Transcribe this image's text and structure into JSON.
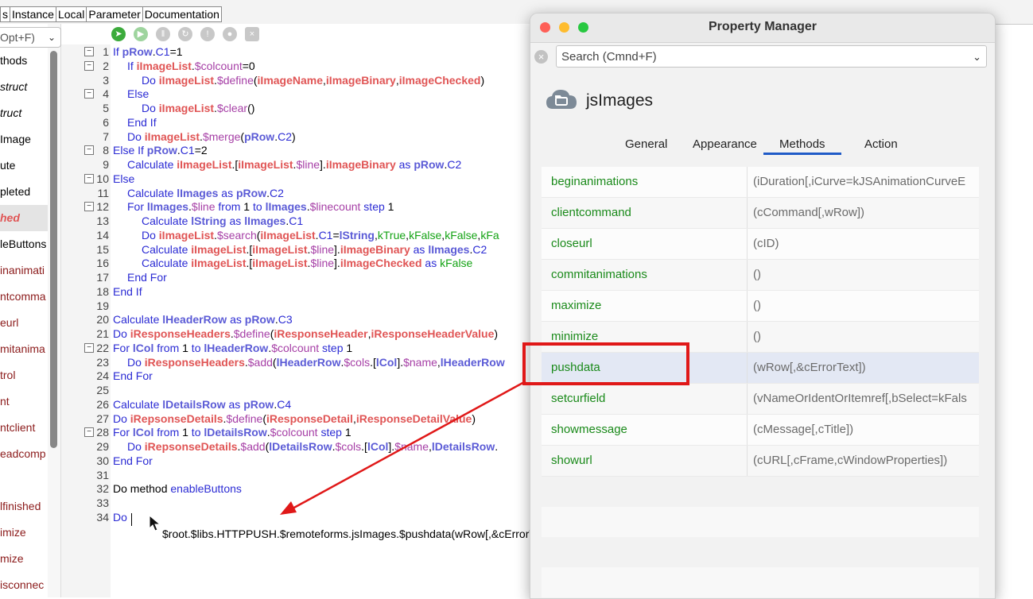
{
  "tabs": [
    "s",
    "Instance",
    "Local",
    "Parameter",
    "Documentation"
  ],
  "left_search": {
    "text": "Opt+F)",
    "chevron": "chevron-down-icon"
  },
  "left_items": [
    {
      "label": "thods",
      "color": "#000000",
      "italic": false
    },
    {
      "label": "struct",
      "color": "#000000",
      "italic": true
    },
    {
      "label": "truct",
      "color": "#000000",
      "italic": true
    },
    {
      "label": "Image",
      "color": "#000000",
      "italic": false
    },
    {
      "label": "ute",
      "color": "#000000",
      "italic": false
    },
    {
      "label": "pleted",
      "color": "#000000",
      "italic": false
    },
    {
      "label": "hed",
      "color": "#e05555",
      "italic": true,
      "selected": true
    },
    {
      "label": "leButtons",
      "color": "#000000",
      "italic": false
    },
    {
      "label": "inanimati",
      "color": "#8b1a1a",
      "italic": false
    },
    {
      "label": "ntcomma",
      "color": "#8b1a1a",
      "italic": false
    },
    {
      "label": "eurl",
      "color": "#8b1a1a",
      "italic": false
    },
    {
      "label": "mitanima",
      "color": "#8b1a1a",
      "italic": false
    },
    {
      "label": "trol",
      "color": "#8b1a1a",
      "italic": false
    },
    {
      "label": "nt",
      "color": "#8b1a1a",
      "italic": false
    },
    {
      "label": "ntclient",
      "color": "#8b1a1a",
      "italic": false
    },
    {
      "label": "eadcomp",
      "color": "#8b1a1a",
      "italic": false
    },
    {
      "label": "",
      "color": "#000000",
      "italic": false
    },
    {
      "label": "lfinished",
      "color": "#8b1a1a",
      "italic": false
    },
    {
      "label": "imize",
      "color": "#8b1a1a",
      "italic": false
    },
    {
      "label": "mize",
      "color": "#8b1a1a",
      "italic": false
    },
    {
      "label": "isconnec",
      "color": "#8b1a1a",
      "italic": false
    }
  ],
  "toolbar_icons": [
    "step-icon",
    "play-icon",
    "pause-icon",
    "refresh-icon",
    "info-icon",
    "user-icon",
    "close-icon"
  ],
  "code_lines": [
    {
      "n": "1",
      "fold": true,
      "ind": 0,
      "t": [
        [
          "kw",
          "If "
        ],
        [
          "lvar",
          "pRow"
        ],
        [
          "plain",
          "."
        ],
        [
          "kw",
          "C1"
        ],
        [
          "plain",
          "=1"
        ]
      ]
    },
    {
      "n": "2",
      "fold": true,
      "ind": 1,
      "t": [
        [
          "kw",
          "If "
        ],
        [
          "var",
          "iImageList"
        ],
        [
          "plain",
          "."
        ],
        [
          "meth",
          "$colcount"
        ],
        [
          "plain",
          "=0"
        ]
      ]
    },
    {
      "n": "3",
      "fold": false,
      "ind": 2,
      "t": [
        [
          "kw",
          "Do "
        ],
        [
          "var",
          "iImageList"
        ],
        [
          "plain",
          "."
        ],
        [
          "meth",
          "$define"
        ],
        [
          "plain",
          "("
        ],
        [
          "var",
          "iImageName"
        ],
        [
          "plain",
          ","
        ],
        [
          "var",
          "iImageBinary"
        ],
        [
          "plain",
          ","
        ],
        [
          "var",
          "iImageChecked"
        ],
        [
          "plain",
          ")"
        ]
      ]
    },
    {
      "n": "4",
      "fold": true,
      "ind": 1,
      "t": [
        [
          "kw",
          "Else"
        ]
      ]
    },
    {
      "n": "5",
      "fold": false,
      "ind": 2,
      "t": [
        [
          "kw",
          "Do "
        ],
        [
          "var",
          "iImageList"
        ],
        [
          "plain",
          "."
        ],
        [
          "meth",
          "$clear"
        ],
        [
          "plain",
          "()"
        ]
      ]
    },
    {
      "n": "6",
      "fold": false,
      "ind": 1,
      "t": [
        [
          "kw",
          "End If"
        ]
      ]
    },
    {
      "n": "7",
      "fold": false,
      "ind": 1,
      "t": [
        [
          "kw",
          "Do "
        ],
        [
          "var",
          "iImageList"
        ],
        [
          "plain",
          "."
        ],
        [
          "meth",
          "$merge"
        ],
        [
          "plain",
          "("
        ],
        [
          "lvar",
          "pRow"
        ],
        [
          "plain",
          "."
        ],
        [
          "kw",
          "C2"
        ],
        [
          "plain",
          ")"
        ]
      ]
    },
    {
      "n": "8",
      "fold": true,
      "ind": 0,
      "t": [
        [
          "kw",
          "Else If "
        ],
        [
          "lvar",
          "pRow"
        ],
        [
          "plain",
          "."
        ],
        [
          "kw",
          "C1"
        ],
        [
          "plain",
          "=2"
        ]
      ]
    },
    {
      "n": "9",
      "fold": false,
      "ind": 1,
      "t": [
        [
          "kw",
          "Calculate "
        ],
        [
          "var",
          "iImageList"
        ],
        [
          "plain",
          ".["
        ],
        [
          "var",
          "iImageList"
        ],
        [
          "plain",
          "."
        ],
        [
          "meth",
          "$line"
        ],
        [
          "plain",
          "]."
        ],
        [
          "var",
          "iImageBinary"
        ],
        [
          "kw",
          " as "
        ],
        [
          "lvar",
          "pRow"
        ],
        [
          "plain",
          "."
        ],
        [
          "kw",
          "C2"
        ]
      ]
    },
    {
      "n": "10",
      "fold": true,
      "ind": 0,
      "t": [
        [
          "kw",
          "Else"
        ]
      ]
    },
    {
      "n": "11",
      "fold": false,
      "ind": 1,
      "t": [
        [
          "kw",
          "Calculate "
        ],
        [
          "lvar",
          "lImages"
        ],
        [
          "kw",
          " as "
        ],
        [
          "lvar",
          "pRow"
        ],
        [
          "plain",
          "."
        ],
        [
          "kw",
          "C2"
        ]
      ]
    },
    {
      "n": "12",
      "fold": true,
      "ind": 1,
      "t": [
        [
          "kw",
          "For "
        ],
        [
          "lvar",
          "lImages"
        ],
        [
          "plain",
          "."
        ],
        [
          "meth",
          "$line"
        ],
        [
          "kw",
          " from "
        ],
        [
          "plain",
          "1"
        ],
        [
          "kw",
          " to "
        ],
        [
          "lvar",
          "lImages"
        ],
        [
          "plain",
          "."
        ],
        [
          "meth",
          "$linecount"
        ],
        [
          "kw",
          " step "
        ],
        [
          "plain",
          "1"
        ]
      ]
    },
    {
      "n": "13",
      "fold": false,
      "ind": 2,
      "t": [
        [
          "kw",
          "Calculate "
        ],
        [
          "lvar",
          "lString"
        ],
        [
          "kw",
          " as "
        ],
        [
          "lvar",
          "lImages"
        ],
        [
          "plain",
          "."
        ],
        [
          "kw",
          "C1"
        ]
      ]
    },
    {
      "n": "14",
      "fold": false,
      "ind": 2,
      "t": [
        [
          "kw",
          "Do "
        ],
        [
          "var",
          "iImageList"
        ],
        [
          "plain",
          "."
        ],
        [
          "meth",
          "$search"
        ],
        [
          "plain",
          "("
        ],
        [
          "var",
          "iImageList"
        ],
        [
          "plain",
          "."
        ],
        [
          "kw",
          "C1"
        ],
        [
          "plain",
          "="
        ],
        [
          "lvar",
          "lString"
        ],
        [
          "plain",
          ","
        ],
        [
          "kc",
          "kTrue"
        ],
        [
          "plain",
          ","
        ],
        [
          "kc",
          "kFalse"
        ],
        [
          "plain",
          ","
        ],
        [
          "kc",
          "kFalse"
        ],
        [
          "plain",
          ","
        ],
        [
          "kc",
          "kFa"
        ]
      ]
    },
    {
      "n": "15",
      "fold": false,
      "ind": 2,
      "t": [
        [
          "kw",
          "Calculate "
        ],
        [
          "var",
          "iImageList"
        ],
        [
          "plain",
          ".["
        ],
        [
          "var",
          "iImageList"
        ],
        [
          "plain",
          "."
        ],
        [
          "meth",
          "$line"
        ],
        [
          "plain",
          "]."
        ],
        [
          "var",
          "iImageBinary"
        ],
        [
          "kw",
          " as "
        ],
        [
          "lvar",
          "lImages"
        ],
        [
          "plain",
          "."
        ],
        [
          "kw",
          "C2"
        ]
      ]
    },
    {
      "n": "16",
      "fold": false,
      "ind": 2,
      "t": [
        [
          "kw",
          "Calculate "
        ],
        [
          "var",
          "iImageList"
        ],
        [
          "plain",
          ".["
        ],
        [
          "var",
          "iImageList"
        ],
        [
          "plain",
          "."
        ],
        [
          "meth",
          "$line"
        ],
        [
          "plain",
          "]."
        ],
        [
          "var",
          "iImageChecked"
        ],
        [
          "kw",
          " as "
        ],
        [
          "kc",
          "kFalse"
        ]
      ]
    },
    {
      "n": "17",
      "fold": false,
      "ind": 1,
      "t": [
        [
          "kw",
          "End For"
        ]
      ]
    },
    {
      "n": "18",
      "fold": false,
      "ind": 0,
      "t": [
        [
          "kw",
          "End If"
        ]
      ]
    },
    {
      "n": "19",
      "fold": false,
      "ind": 0,
      "t": []
    },
    {
      "n": "20",
      "fold": false,
      "ind": 0,
      "t": [
        [
          "kw",
          "Calculate "
        ],
        [
          "lvar",
          "lHeaderRow"
        ],
        [
          "kw",
          " as "
        ],
        [
          "lvar",
          "pRow"
        ],
        [
          "plain",
          "."
        ],
        [
          "kw",
          "C3"
        ]
      ]
    },
    {
      "n": "21",
      "fold": false,
      "ind": 0,
      "t": [
        [
          "kw",
          "Do "
        ],
        [
          "var",
          "iResponseHeaders"
        ],
        [
          "plain",
          "."
        ],
        [
          "meth",
          "$define"
        ],
        [
          "plain",
          "("
        ],
        [
          "var",
          "iResponseHeader"
        ],
        [
          "plain",
          ","
        ],
        [
          "var",
          "iResponseHeaderValue"
        ],
        [
          "plain",
          ")"
        ]
      ]
    },
    {
      "n": "22",
      "fold": true,
      "ind": 0,
      "t": [
        [
          "kw",
          "For "
        ],
        [
          "lvar",
          "lCol"
        ],
        [
          "kw",
          " from "
        ],
        [
          "plain",
          "1"
        ],
        [
          "kw",
          " to "
        ],
        [
          "lvar",
          "lHeaderRow"
        ],
        [
          "plain",
          "."
        ],
        [
          "meth",
          "$colcount"
        ],
        [
          "kw",
          " step "
        ],
        [
          "plain",
          "1"
        ]
      ]
    },
    {
      "n": "23",
      "fold": false,
      "ind": 1,
      "t": [
        [
          "kw",
          "Do "
        ],
        [
          "var",
          "iResponseHeaders"
        ],
        [
          "plain",
          "."
        ],
        [
          "meth",
          "$add"
        ],
        [
          "plain",
          "("
        ],
        [
          "lvar",
          "lHeaderRow"
        ],
        [
          "plain",
          "."
        ],
        [
          "meth",
          "$cols"
        ],
        [
          "plain",
          ".["
        ],
        [
          "lvar",
          "lCol"
        ],
        [
          "plain",
          "]."
        ],
        [
          "meth",
          "$name"
        ],
        [
          "plain",
          ","
        ],
        [
          "lvar",
          "lHeaderRow"
        ]
      ]
    },
    {
      "n": "24",
      "fold": false,
      "ind": 0,
      "t": [
        [
          "kw",
          "End For"
        ]
      ]
    },
    {
      "n": "25",
      "fold": false,
      "ind": 0,
      "t": []
    },
    {
      "n": "26",
      "fold": false,
      "ind": 0,
      "t": [
        [
          "kw",
          "Calculate "
        ],
        [
          "lvar",
          "lDetailsRow"
        ],
        [
          "kw",
          " as "
        ],
        [
          "lvar",
          "pRow"
        ],
        [
          "plain",
          "."
        ],
        [
          "kw",
          "C4"
        ]
      ]
    },
    {
      "n": "27",
      "fold": false,
      "ind": 0,
      "t": [
        [
          "kw",
          "Do "
        ],
        [
          "var",
          "iRepsonseDetails"
        ],
        [
          "plain",
          "."
        ],
        [
          "meth",
          "$define"
        ],
        [
          "plain",
          "("
        ],
        [
          "var",
          "iResponseDetail"
        ],
        [
          "plain",
          ","
        ],
        [
          "var",
          "iResponseDetailValue"
        ],
        [
          "plain",
          ")"
        ]
      ]
    },
    {
      "n": "28",
      "fold": true,
      "ind": 0,
      "t": [
        [
          "kw",
          "For "
        ],
        [
          "lvar",
          "lCol"
        ],
        [
          "kw",
          " from "
        ],
        [
          "plain",
          "1"
        ],
        [
          "kw",
          " to "
        ],
        [
          "lvar",
          "lDetailsRow"
        ],
        [
          "plain",
          "."
        ],
        [
          "meth",
          "$colcount"
        ],
        [
          "kw",
          " step "
        ],
        [
          "plain",
          "1"
        ]
      ]
    },
    {
      "n": "29",
      "fold": false,
      "ind": 1,
      "t": [
        [
          "kw",
          "Do "
        ],
        [
          "var",
          "iRepsonseDetails"
        ],
        [
          "plain",
          "."
        ],
        [
          "meth",
          "$add"
        ],
        [
          "plain",
          "("
        ],
        [
          "lvar",
          "lDetailsRow"
        ],
        [
          "plain",
          "."
        ],
        [
          "meth",
          "$cols"
        ],
        [
          "plain",
          ".["
        ],
        [
          "lvar",
          "lCol"
        ],
        [
          "plain",
          "]."
        ],
        [
          "meth",
          "$name"
        ],
        [
          "plain",
          ","
        ],
        [
          "lvar",
          "lDetailsRow"
        ],
        [
          "plain",
          "."
        ]
      ]
    },
    {
      "n": "30",
      "fold": false,
      "ind": 0,
      "t": [
        [
          "kw",
          "End For"
        ]
      ]
    },
    {
      "n": "31",
      "fold": false,
      "ind": 0,
      "t": []
    },
    {
      "n": "32",
      "fold": false,
      "ind": 0,
      "t": [
        [
          "plain",
          "Do method "
        ],
        [
          "kw",
          "enableButtons"
        ]
      ]
    },
    {
      "n": "33",
      "fold": false,
      "ind": 0,
      "t": []
    },
    {
      "n": "34",
      "fold": false,
      "ind": 0,
      "t": [
        [
          "kw",
          "Do"
        ]
      ]
    }
  ],
  "autocomplete_hint": "$root.$libs.HTTPPUSH.$remoteforms.jsImages.$pushdata(wRow[,&cErrorText])",
  "property_manager": {
    "title": "Property Manager",
    "search_placeholder": "Search (Cmnd+F)",
    "object_name": "jsImages",
    "object_icon": "cloud-folder-icon",
    "tabs": [
      {
        "label": "General",
        "active": false
      },
      {
        "label": "Appearance",
        "active": false
      },
      {
        "label": "Methods",
        "active": true
      },
      {
        "label": "Action",
        "active": false
      }
    ],
    "methods": [
      {
        "name": "beginanimations",
        "args": "(iDuration[,iCurve=kJSAnimationCurveE"
      },
      {
        "name": "clientcommand",
        "args": "(cCommand[,wRow])"
      },
      {
        "name": "closeurl",
        "args": "(cID)"
      },
      {
        "name": "commitanimations",
        "args": "()"
      },
      {
        "name": "maximize",
        "args": "()"
      },
      {
        "name": "minimize",
        "args": "()"
      },
      {
        "name": "pushdata",
        "args": "(wRow[,&cErrorText])",
        "selected": true
      },
      {
        "name": "setcurfield",
        "args": "(vNameOrIdentOrItemref[,bSelect=kFals"
      },
      {
        "name": "showmessage",
        "args": "(cMessage[,cTitle])"
      },
      {
        "name": "showurl",
        "args": "(cURL[,cFrame,cWindowProperties])"
      }
    ],
    "accent": "#1f5bc7",
    "method_color": "#1a8a1a"
  },
  "annotation_color": "#e01818"
}
